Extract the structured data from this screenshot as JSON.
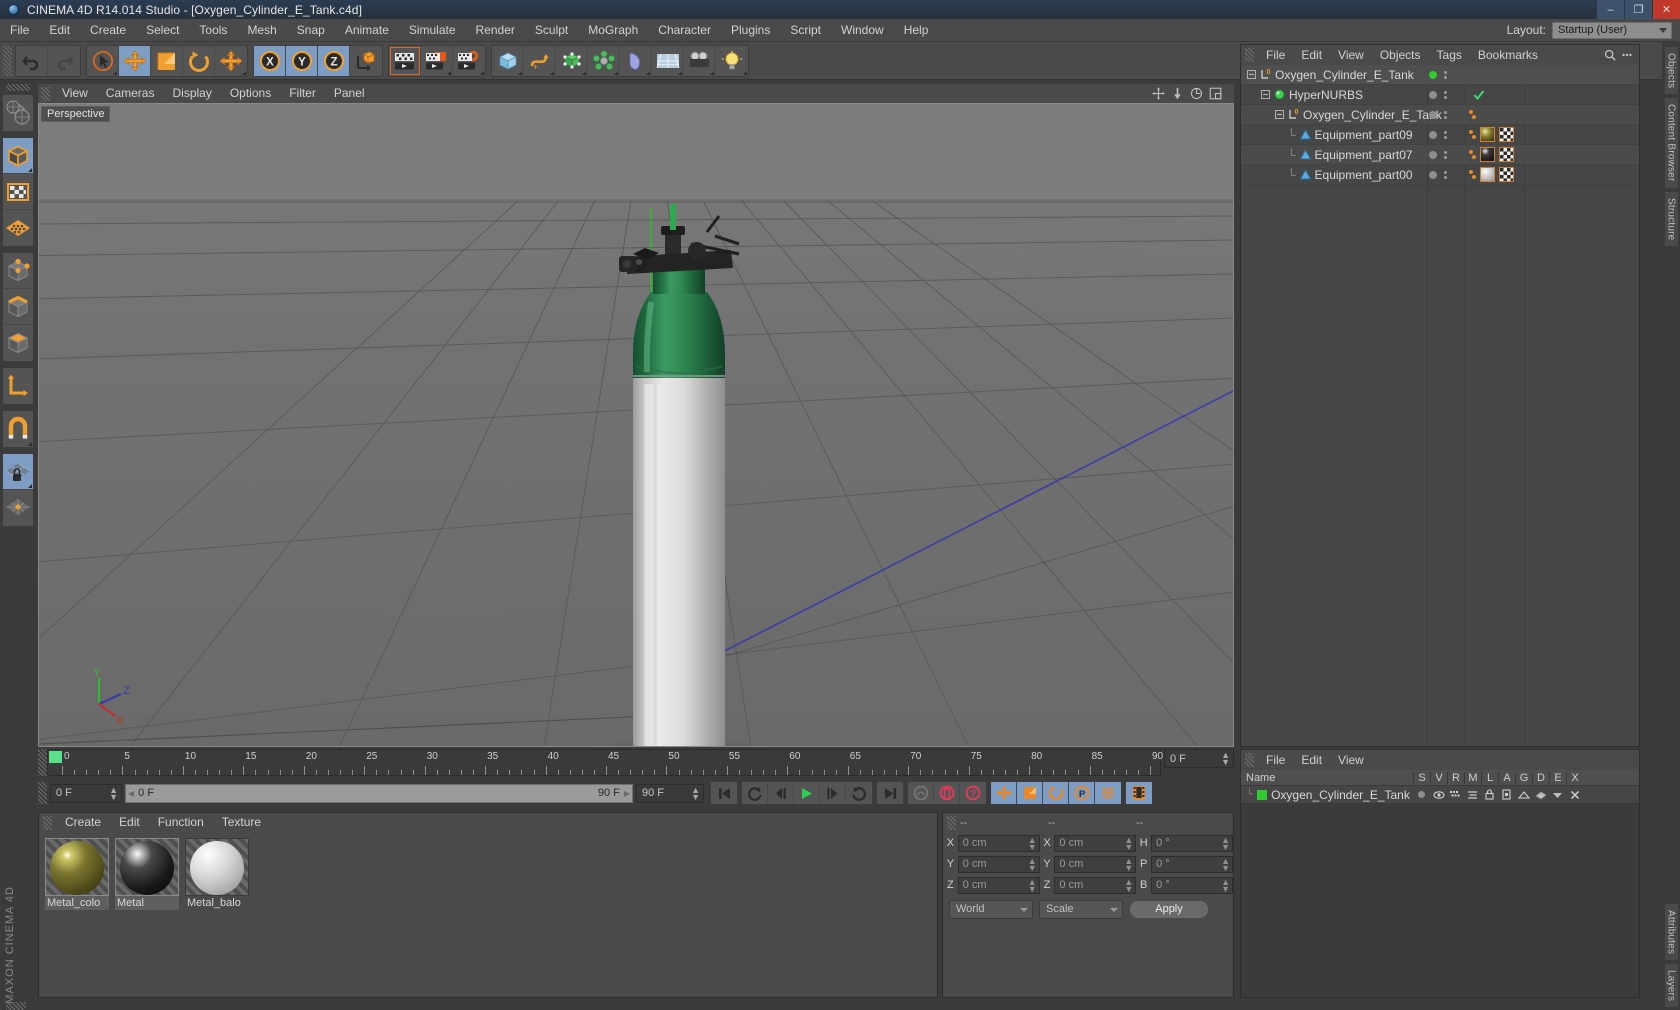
{
  "titlebar": {
    "title": "CINEMA 4D R14.014 Studio - [Oxygen_Cylinder_E_Tank.c4d]",
    "minimize": "–",
    "maximize": "❐",
    "close": "✕"
  },
  "menubar": {
    "items": [
      "File",
      "Edit",
      "Create",
      "Select",
      "Tools",
      "Mesh",
      "Snap",
      "Animate",
      "Simulate",
      "Render",
      "Sculpt",
      "MoGraph",
      "Character",
      "Plugins",
      "Script",
      "Window",
      "Help"
    ],
    "layout_label": "Layout:",
    "layout_value": "Startup (User)"
  },
  "toolbar": {
    "groups": [
      {
        "name": "history",
        "buttons": [
          {
            "name": "undo-button",
            "icon": "undo-icon",
            "state": "normal"
          },
          {
            "name": "redo-button",
            "icon": "redo-icon",
            "state": "disabled"
          }
        ]
      },
      {
        "name": "transform",
        "buttons": [
          {
            "name": "select-tool",
            "icon": "cursor-select-icon",
            "state": "normal"
          },
          {
            "name": "move-tool",
            "icon": "move-arrows-icon",
            "state": "active"
          },
          {
            "name": "scale-tool",
            "icon": "scale-icon",
            "state": "normal"
          },
          {
            "name": "rotate-tool",
            "icon": "rotate-icon",
            "state": "normal"
          },
          {
            "name": "move-free-tool",
            "icon": "move-plus-icon",
            "state": "normal"
          }
        ]
      },
      {
        "name": "axis-locks",
        "buttons": [
          {
            "name": "lock-x-axis",
            "icon": "x-axis-icon",
            "state": "active",
            "label": "X"
          },
          {
            "name": "lock-y-axis",
            "icon": "y-axis-icon",
            "state": "active",
            "label": "Y"
          },
          {
            "name": "lock-z-axis",
            "icon": "z-axis-icon",
            "state": "active",
            "label": "Z"
          },
          {
            "name": "world-coordinates",
            "icon": "world-axis-icon",
            "state": "normal"
          }
        ]
      },
      {
        "name": "render",
        "buttons": [
          {
            "name": "render-view",
            "icon": "render-view-icon",
            "state": "selected"
          },
          {
            "name": "render-region",
            "icon": "render-region-icon",
            "state": "normal"
          },
          {
            "name": "render-settings",
            "icon": "render-settings-icon",
            "state": "normal"
          }
        ]
      },
      {
        "name": "objects",
        "buttons": [
          {
            "name": "add-cube",
            "icon": "cube-icon",
            "state": "normal"
          },
          {
            "name": "add-spline",
            "icon": "spline-icon",
            "state": "normal"
          },
          {
            "name": "add-nurbs",
            "icon": "hypernurbs-icon",
            "state": "normal"
          },
          {
            "name": "add-array",
            "icon": "array-icon",
            "state": "normal"
          },
          {
            "name": "add-deformer",
            "icon": "bend-deformer-icon",
            "state": "normal"
          },
          {
            "name": "add-environment",
            "icon": "floor-environment-icon",
            "state": "normal"
          },
          {
            "name": "add-camera",
            "icon": "camera-icon",
            "state": "normal"
          },
          {
            "name": "add-light",
            "icon": "light-bulb-icon",
            "state": "normal"
          }
        ]
      }
    ]
  },
  "lefttoolbar": {
    "groups": [
      [
        {
          "name": "make-editable-button",
          "icon": "make-editable-icon",
          "state": "normal"
        }
      ],
      [
        {
          "name": "model-mode-button",
          "icon": "model-cube-icon",
          "state": "active"
        },
        {
          "name": "texture-mode-button",
          "icon": "texture-checker-icon",
          "state": "normal"
        },
        {
          "name": "uv-polygon-mode-button",
          "icon": "uv-mesh-icon",
          "state": "normal"
        }
      ],
      [
        {
          "name": "points-mode-button",
          "icon": "points-cube-icon",
          "state": "normal"
        },
        {
          "name": "edges-mode-button",
          "icon": "edges-cube-icon",
          "state": "normal"
        },
        {
          "name": "polygons-mode-button",
          "icon": "polygons-cube-icon",
          "state": "normal"
        }
      ],
      [
        {
          "name": "object-axis-mode-button",
          "icon": "axis-l-icon",
          "state": "normal"
        }
      ],
      [
        {
          "name": "enable-snap-button",
          "icon": "magnet-icon",
          "state": "normal"
        }
      ],
      [
        {
          "name": "lock-workplane-button",
          "icon": "workplane-lock-icon",
          "state": "active"
        },
        {
          "name": "workplane-button",
          "icon": "workplane-icon",
          "state": "normal"
        }
      ]
    ]
  },
  "viewport": {
    "menu": [
      "View",
      "Cameras",
      "Display",
      "Options",
      "Filter",
      "Panel"
    ],
    "label": "Perspective",
    "axis_labels": {
      "y": "Y",
      "z": "Z",
      "x": "X"
    },
    "corner_icons": [
      "pan-icon",
      "dolly-icon",
      "orbit-icon",
      "maximize-view-icon"
    ]
  },
  "timeline": {
    "ticks": [
      "0",
      "5",
      "10",
      "15",
      "20",
      "25",
      "30",
      "35",
      "40",
      "45",
      "50",
      "55",
      "60",
      "65",
      "70",
      "75",
      "80",
      "85",
      "90"
    ],
    "current_frame_right": "0 F",
    "current_frame_field": "0 F",
    "slider_start": "0 F",
    "slider_end": "90 F",
    "end_frame_field": "90 F",
    "buttons": [
      {
        "name": "go-to-start-button",
        "icon": "skip-start-icon"
      },
      {
        "name": "go-to-previous-key-button",
        "icon": "prev-key-icon"
      },
      {
        "name": "go-to-previous-frame-button",
        "icon": "step-back-icon"
      },
      {
        "name": "play-button",
        "icon": "play-icon"
      },
      {
        "name": "go-to-next-frame-button",
        "icon": "step-forward-icon"
      },
      {
        "name": "go-to-next-key-button",
        "icon": "next-key-icon"
      },
      {
        "name": "go-to-end-button",
        "icon": "skip-end-icon"
      },
      {
        "name": "record-active-objects-button",
        "icon": "record-icon"
      },
      {
        "name": "autokeying-button",
        "icon": "autokey-icon"
      },
      {
        "name": "keyframe-selection-button",
        "icon": "key-selection-icon"
      },
      {
        "name": "position-key-button",
        "icon": "position-key-icon"
      },
      {
        "name": "scale-key-button",
        "icon": "scale-key-icon"
      },
      {
        "name": "rotation-key-button",
        "icon": "rotation-key-icon"
      },
      {
        "name": "parameter-key-button",
        "icon": "param-key-icon"
      },
      {
        "name": "point-level-animation-button",
        "icon": "pla-dots-icon"
      },
      {
        "name": "timeline-filmstrip-button",
        "icon": "filmstrip-icon"
      }
    ]
  },
  "material_manager": {
    "menu": [
      "Create",
      "Edit",
      "Function",
      "Texture"
    ],
    "materials": [
      {
        "name": "Metal_colo",
        "color": "#6e6a2a",
        "selected": true
      },
      {
        "name": "Metal",
        "color": "#1a1a1a",
        "selected": true
      },
      {
        "name": "Metal_balo",
        "color": "#d8d8d8",
        "selected": false
      }
    ]
  },
  "coordinates": {
    "headers": [
      "--",
      "--",
      "--"
    ],
    "rows": [
      {
        "pos_label": "X",
        "pos_value": "0 cm",
        "size_label": "X",
        "size_value": "0 cm",
        "rot_label": "H",
        "rot_value": "0 °"
      },
      {
        "pos_label": "Y",
        "pos_value": "0 cm",
        "size_label": "Y",
        "size_value": "0 cm",
        "rot_label": "P",
        "rot_value": "0 °"
      },
      {
        "pos_label": "Z",
        "pos_value": "0 cm",
        "size_label": "Z",
        "size_value": "0 cm",
        "rot_label": "B",
        "rot_value": "0 °"
      }
    ],
    "system_dropdown": "World",
    "mode_dropdown": "Scale",
    "apply_button": "Apply"
  },
  "object_manager": {
    "menu": [
      "File",
      "Edit",
      "View",
      "Objects",
      "Tags",
      "Bookmarks"
    ],
    "search_icon": "search-icon",
    "options_icon": "options-icon",
    "tree": [
      {
        "label": "Oxygen_Cylinder_E_Tank",
        "depth": 0,
        "icon": "null-object-icon",
        "selected": true,
        "visdot": "green",
        "tags": []
      },
      {
        "label": "HyperNURBS",
        "depth": 1,
        "icon": "hypernurbs-green-icon",
        "selected": false,
        "visdot": "gray",
        "check": true,
        "tags": []
      },
      {
        "label": "Oxygen_Cylinder_E_Tank",
        "depth": 2,
        "icon": "null-object-icon",
        "selected": false,
        "visdot": "gray",
        "tags": [
          "dots"
        ]
      },
      {
        "label": "Equipment_part09",
        "depth": 3,
        "icon": "polygon-object-icon",
        "selected": false,
        "visdot": "gray",
        "tags": [
          "dots",
          "material-olive",
          "texture-checker"
        ]
      },
      {
        "label": "Equipment_part07",
        "depth": 3,
        "icon": "polygon-object-icon",
        "selected": false,
        "visdot": "gray",
        "tags": [
          "dots",
          "material-black",
          "texture-checker"
        ]
      },
      {
        "label": "Equipment_part00",
        "depth": 3,
        "icon": "polygon-object-icon",
        "selected": false,
        "visdot": "gray",
        "tags": [
          "dots",
          "material-white",
          "texture-checker"
        ]
      }
    ]
  },
  "layer_manager": {
    "menu": [
      "File",
      "Edit",
      "View"
    ],
    "columns": [
      "Name",
      "S",
      "V",
      "R",
      "M",
      "L",
      "A",
      "G",
      "D",
      "E",
      "X"
    ],
    "rows": [
      {
        "name": "Oxygen_Cylinder_E_Tank",
        "color": "#2ecc2e"
      }
    ]
  },
  "right_tabs_top": [
    "Objects",
    "Content Browser",
    "Structure"
  ],
  "right_tabs_bottom": [
    "Attributes",
    "Layers"
  ],
  "brand": {
    "line1": "MAXON",
    "line2": "CINEMA 4D"
  },
  "colors": {
    "accent_orange": "#e08a2a",
    "active_blue": "#7e9dc4",
    "green": "#2ecc2e",
    "panel_bg": "#4a4a4a",
    "viewport_bg": "#6e6e6e"
  }
}
